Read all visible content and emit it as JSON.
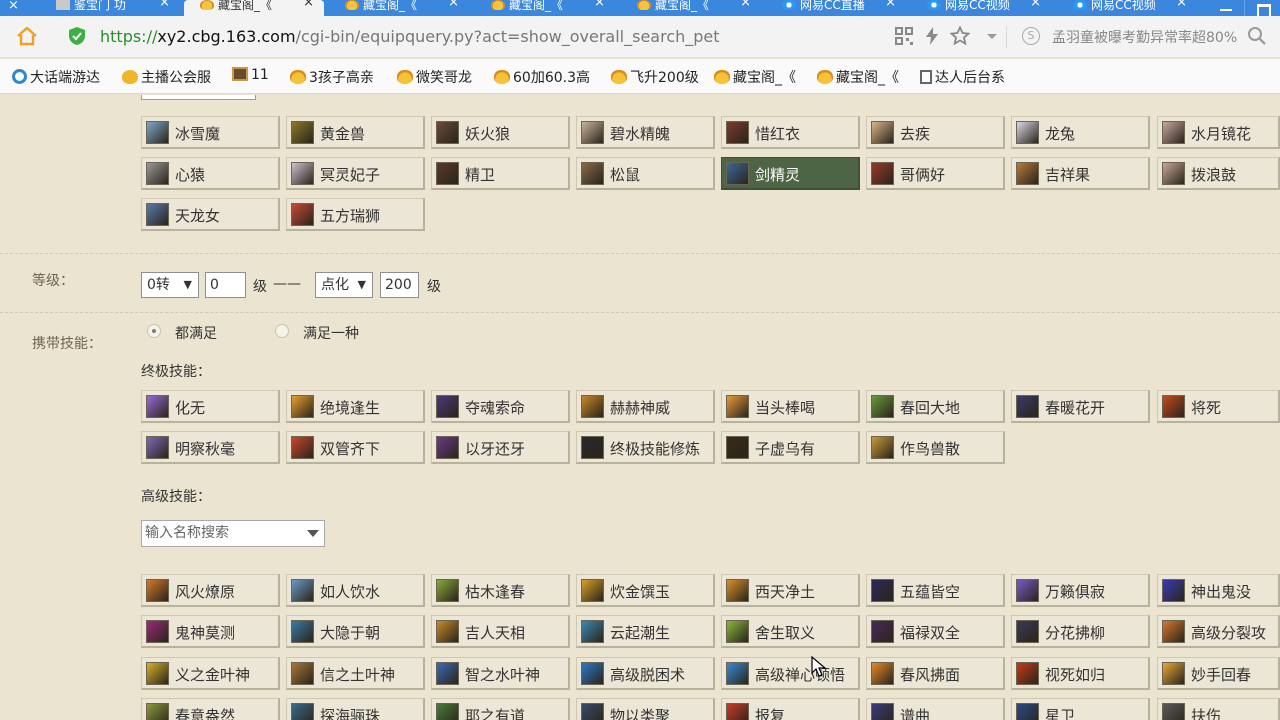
{
  "tabs": [
    {
      "label": "鉴宝门 功",
      "favicon": "doc",
      "active": false
    },
    {
      "label": "藏宝阁_《",
      "favicon": "cbg",
      "active": true
    },
    {
      "label": "藏宝阁_《",
      "favicon": "cbg",
      "active": false
    },
    {
      "label": "藏宝阁_《",
      "favicon": "cbg",
      "active": false
    },
    {
      "label": "藏宝阁_《",
      "favicon": "cbg",
      "active": false
    },
    {
      "label": "网易CC直播",
      "favicon": "cc",
      "active": false
    },
    {
      "label": "网易CC视频",
      "favicon": "cc",
      "active": false
    },
    {
      "label": "网易CC视频",
      "favicon": "cc",
      "active": false
    }
  ],
  "address": {
    "scheme": "https://",
    "domain": "xy2.cbg.163.com",
    "path": "/cgi-bin/equipquery.py?act=show_overall_search_pet",
    "search_hint": "孟羽童被曝考勤异常率超80%"
  },
  "bookmarks": [
    {
      "label": "大话端游达",
      "icon": "e"
    },
    {
      "label": "主播公会服",
      "icon": "g"
    },
    {
      "label": "11",
      "icon": "p"
    },
    {
      "label": "3孩子高亲",
      "icon": "gold"
    },
    {
      "label": "微笑哥龙",
      "icon": "gold"
    },
    {
      "label": "60加60.3高",
      "icon": "gold"
    },
    {
      "label": "飞升200级",
      "icon": "gold"
    },
    {
      "label": "藏宝阁_《",
      "icon": "gold"
    },
    {
      "label": "藏宝阁_《",
      "icon": "gold"
    },
    {
      "label": "达人后台系",
      "icon": "docu"
    }
  ],
  "pet_types": [
    {
      "label": "冰雪魔",
      "selected": false,
      "color": "#7fa8c9"
    },
    {
      "label": "黄金兽",
      "selected": false,
      "color": "#8a7a2a"
    },
    {
      "label": "妖火狼",
      "selected": false,
      "color": "#6b4a3a"
    },
    {
      "label": "碧水精魄",
      "selected": false,
      "color": "#c9b49a"
    },
    {
      "label": "惜红衣",
      "selected": false,
      "color": "#7a3b2e"
    },
    {
      "label": "去疾",
      "selected": false,
      "color": "#d9b48a"
    },
    {
      "label": "龙兔",
      "selected": false,
      "color": "#d8d8e8"
    },
    {
      "label": "水月镜花",
      "selected": false,
      "color": "#c8a8a0"
    },
    {
      "label": "心猿",
      "selected": false,
      "color": "#9a9a9a"
    },
    {
      "label": "冥灵妃子",
      "selected": false,
      "color": "#d0c0d0"
    },
    {
      "label": "精卫",
      "selected": false,
      "color": "#5a3a2a"
    },
    {
      "label": "松鼠",
      "selected": false,
      "color": "#8a6a4a"
    },
    {
      "label": "剑精灵",
      "selected": true,
      "color": "#3a6a9a"
    },
    {
      "label": "哥俩好",
      "selected": false,
      "color": "#9a3a2a"
    },
    {
      "label": "吉祥果",
      "selected": false,
      "color": "#b87a3a"
    },
    {
      "label": "拨浪鼓",
      "selected": false,
      "color": "#c9a89a"
    },
    {
      "label": "天龙女",
      "selected": false,
      "color": "#5a7aaa"
    },
    {
      "label": "五方瑞狮",
      "selected": false,
      "color": "#c94a3a"
    }
  ],
  "level": {
    "label": "等级：",
    "from_turn": "0转",
    "from_level": "0",
    "unit_ji": "级",
    "dash": "——",
    "to_turn": "点化",
    "to_level": "200"
  },
  "skills": {
    "label": "携带技能：",
    "radio_all": "都满足",
    "radio_any": "满足一种",
    "ultimate_label": "终极技能：",
    "advanced_label": "高级技能：",
    "search_placeholder": "输入名称搜索"
  },
  "ultimate_skills": [
    {
      "label": "化无",
      "color": "#9a6ad8"
    },
    {
      "label": "绝境逢生",
      "color": "#e8a030"
    },
    {
      "label": "夺魂索命",
      "color": "#4a3a7a"
    },
    {
      "label": "赫赫神威",
      "color": "#c8882a"
    },
    {
      "label": "当头棒喝",
      "color": "#e89a3a"
    },
    {
      "label": "春回大地",
      "color": "#6a9a3a"
    },
    {
      "label": "春暖花开",
      "color": "#3a3a6a"
    },
    {
      "label": "将死",
      "color": "#c84a1a"
    },
    {
      "label": "明察秋毫",
      "color": "#7a6ab8"
    },
    {
      "label": "双管齐下",
      "color": "#c8482a"
    },
    {
      "label": "以牙还牙",
      "color": "#6a3a8a"
    },
    {
      "label": "终极技能修炼",
      "color": "#2a2a2a"
    },
    {
      "label": "子虚乌有",
      "color": "#3a2a1a"
    },
    {
      "label": "作鸟兽散",
      "color": "#c89a3a"
    }
  ],
  "advanced_skills": [
    {
      "label": "风火燎原",
      "color": "#d8782a"
    },
    {
      "label": "如人饮水",
      "color": "#6a9ac8"
    },
    {
      "label": "枯木逢春",
      "color": "#8aa83a"
    },
    {
      "label": "炊金馔玉",
      "color": "#d8a02a"
    },
    {
      "label": "西天净土",
      "color": "#d8902a"
    },
    {
      "label": "五蕴皆空",
      "color": "#2a2a5a"
    },
    {
      "label": "万籁俱寂",
      "color": "#7a5ac8"
    },
    {
      "label": "神出鬼没",
      "color": "#3a3ab8"
    },
    {
      "label": "鬼神莫测",
      "color": "#9a2a7a"
    },
    {
      "label": "大隐于朝",
      "color": "#3a7aa8"
    },
    {
      "label": "吉人天相",
      "color": "#c88a2a"
    },
    {
      "label": "云起潮生",
      "color": "#3a8ab8"
    },
    {
      "label": "舍生取义",
      "color": "#8ab83a"
    },
    {
      "label": "福禄双全",
      "color": "#4a2a5a"
    },
    {
      "label": "分花拂柳",
      "color": "#3a3a5a"
    },
    {
      "label": "高级分裂攻",
      "color": "#d8782a"
    },
    {
      "label": "义之金叶神",
      "color": "#d8b02a"
    },
    {
      "label": "信之土叶神",
      "color": "#a8783a"
    },
    {
      "label": "智之水叶神",
      "color": "#3a6ab8"
    },
    {
      "label": "高级脱困术",
      "color": "#2a7ac8"
    },
    {
      "label": "高级禅心顿悟",
      "color": "#3a8ad8"
    },
    {
      "label": "春风拂面",
      "color": "#e8882a"
    },
    {
      "label": "视死如归",
      "color": "#c83a1a"
    },
    {
      "label": "妙手回春",
      "color": "#e8a83a"
    },
    {
      "label": "春意盎然",
      "color": "#8a9a3a"
    },
    {
      "label": "探海骊珠",
      "color": "#3a6a8a"
    },
    {
      "label": "耶之有道",
      "color": "#4a7a3a"
    },
    {
      "label": "物以类聚",
      "color": "#3a4a6a"
    },
    {
      "label": "报复",
      "color": "#c83a2a"
    },
    {
      "label": "谱曲",
      "color": "#3a3a7a"
    },
    {
      "label": "星卫",
      "color": "#2a4a8a"
    },
    {
      "label": "扶伤",
      "color": "#5a5a5a"
    }
  ]
}
